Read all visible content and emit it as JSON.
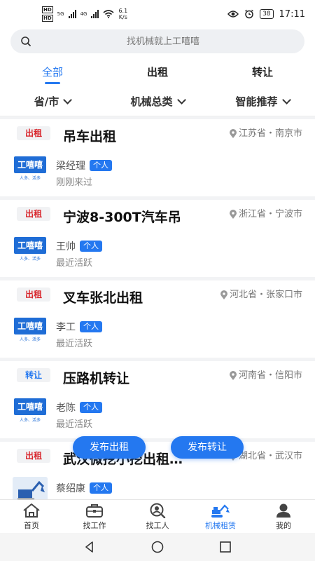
{
  "status_bar": {
    "hd1": "HD",
    "hd2": "HD",
    "net1": "5G",
    "net2": "4G",
    "speed_value": "6.1",
    "speed_unit": "K/s",
    "battery": "38",
    "time": "17:11"
  },
  "search": {
    "placeholder": "找机械就上工嘻嘻"
  },
  "tabs": [
    {
      "label": "全部",
      "active": true
    },
    {
      "label": "出租",
      "active": false
    },
    {
      "label": "转让",
      "active": false
    }
  ],
  "filters": [
    {
      "label": "省/市"
    },
    {
      "label": "机械总类"
    },
    {
      "label": "智能推荐"
    }
  ],
  "listings": [
    {
      "tag": "出租",
      "title": "吊车出租",
      "location": "江苏省・南京市",
      "name": "梁经理",
      "badge": "个人",
      "activity": "刚刚来过",
      "logo_text": "工嘻嘻",
      "logo_sub": "人多、活多"
    },
    {
      "tag": "出租",
      "title": "宁波8-300T汽车吊",
      "location": "浙江省・宁波市",
      "name": "王帅",
      "badge": "个人",
      "activity": "最近活跃",
      "logo_text": "工嘻嘻",
      "logo_sub": "人多、活多"
    },
    {
      "tag": "出租",
      "title": "叉车张北出租",
      "location": "河北省・张家口市",
      "name": "李工",
      "badge": "个人",
      "activity": "最近活跃",
      "logo_text": "工嘻嘻",
      "logo_sub": "人多、活多"
    },
    {
      "tag": "转让",
      "title": "压路机转让",
      "location": "河南省・信阳市",
      "name": "老陈",
      "badge": "个人",
      "activity": "最近活跃",
      "logo_text": "工嘻嘻",
      "logo_sub": "人多、活多"
    },
    {
      "tag": "出租",
      "title": "武汉微挖小挖出租…",
      "location": "湖北省・武汉市",
      "name": "蔡绍康",
      "badge": "个人",
      "activity": ""
    }
  ],
  "float_buttons": {
    "publish_rent": "发布出租",
    "publish_transfer": "发布转让"
  },
  "bottom_nav": [
    {
      "label": "首页",
      "icon": "home-icon"
    },
    {
      "label": "找工作",
      "icon": "briefcase-icon"
    },
    {
      "label": "找工人",
      "icon": "find-worker-icon"
    },
    {
      "label": "机械租赁",
      "icon": "excavator-icon",
      "active": true
    },
    {
      "label": "我的",
      "icon": "profile-icon"
    }
  ],
  "colors": {
    "accent": "#2478f0",
    "rent_tag": "#d8262c",
    "transfer_tag": "#2478f0"
  }
}
